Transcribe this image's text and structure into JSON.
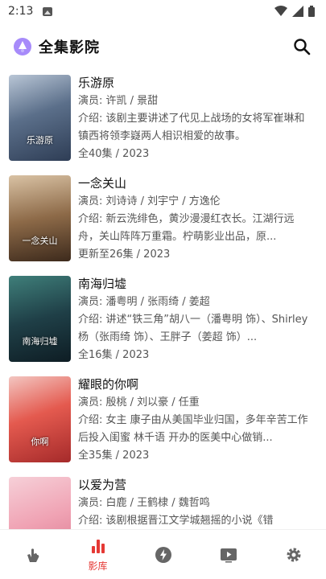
{
  "status_bar": {
    "time": "2:13"
  },
  "app": {
    "title": "全集影院"
  },
  "items": [
    {
      "title": "乐游原",
      "cast": "演员: 许凯 / 景甜",
      "intro": "介绍: 该剧主要讲述了代见上战场的女将军崔琳和镇西将领李嶷两人相识相爱的故事。",
      "episodes": "全40集 / 2023",
      "poster_text": "乐游原"
    },
    {
      "title": "一念关山",
      "cast": "演员: 刘诗诗 / 刘宇宁 / 方逸伦",
      "intro": "介绍: 新云洗绯色，黄沙漫漫红衣长。江湖行远舟，关山阵阵万重霜。柠萌影业出品，原...",
      "episodes": "更新至26集 / 2023",
      "poster_text": "一念关山"
    },
    {
      "title": "南海归墟",
      "cast": "演员: 潘粤明 / 张雨绮 / 姜超",
      "intro": "介绍: 讲述“铁三角”胡八一（潘粤明 饰）、Shirley杨（张雨绮 饰）、王胖子（姜超 饰）...",
      "episodes": "全16集 / 2023",
      "poster_text": "南海归墟"
    },
    {
      "title": "耀眼的你啊",
      "cast": "演员: 殷桃 / 刘以豪 / 任重",
      "intro": "介绍: 女主 康子由从美国毕业归国，多年辛苦工作后投入闺蜜 林千语 开办的医美中心做销...",
      "episodes": "全35集 / 2023",
      "poster_text": "你啊"
    },
    {
      "title": "以爱为营",
      "cast": "演员: 白鹿 / 王鹤棣 / 魏哲鸣",
      "intro": "介绍: 该剧根据晋江文学城翘摇的小说《错",
      "episodes": "",
      "poster_text": ""
    }
  ],
  "tabs": [
    {
      "icon": "hand-icon",
      "label": ""
    },
    {
      "icon": "library-bars-icon",
      "label": "影库"
    },
    {
      "icon": "bolt-icon",
      "label": ""
    },
    {
      "icon": "play-box-icon",
      "label": ""
    },
    {
      "icon": "gear-icon",
      "label": ""
    }
  ],
  "colors": {
    "accent": "#e53935",
    "icon_gray": "#666666"
  }
}
